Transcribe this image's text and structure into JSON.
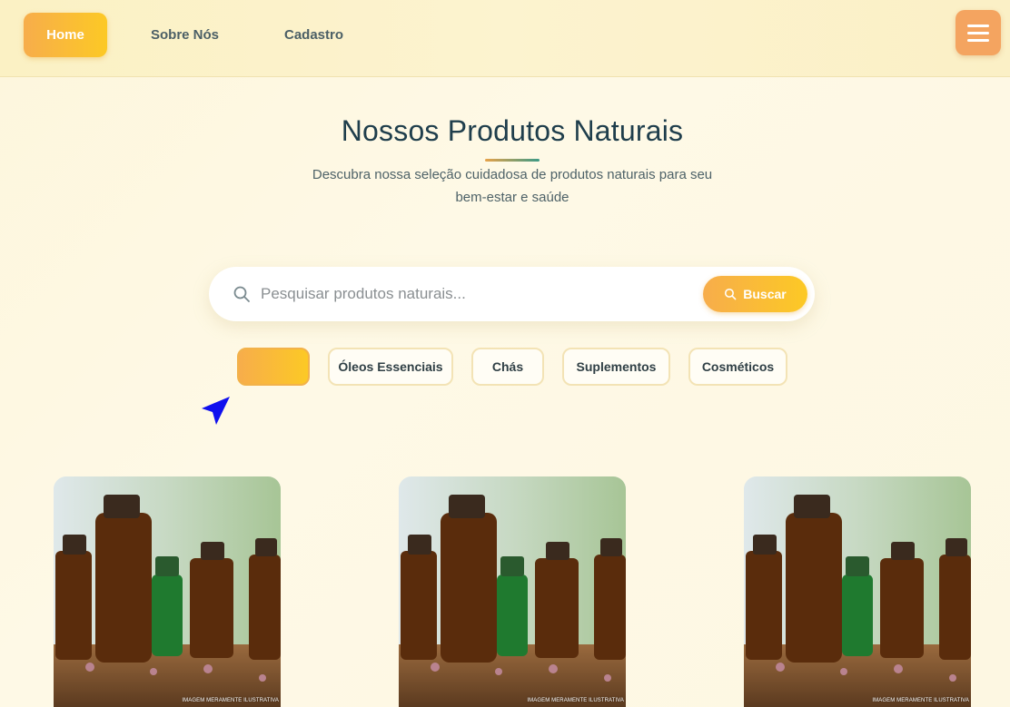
{
  "nav": {
    "home_label": "Home",
    "about_label": "Sobre Nós",
    "register_label": "Cadastro",
    "menu_icon": "hamburger-menu-icon"
  },
  "hero": {
    "title": "Nossos Produtos Naturais",
    "subtitle": "Descubra nossa seleção cuidadosa de produtos naturais para seu bem-estar e saúde"
  },
  "search": {
    "placeholder": "Pesquisar produtos naturais...",
    "value": "",
    "button_label": "Buscar",
    "icon": "search-icon"
  },
  "filters": [
    {
      "label": "",
      "active": true
    },
    {
      "label": "Óleos Essenciais",
      "active": false
    },
    {
      "label": "Chás",
      "active": false
    },
    {
      "label": "Suplementos",
      "active": false
    },
    {
      "label": "Cosméticos",
      "active": false
    }
  ],
  "products": [
    {
      "image_caption": "IMAGEM MERAMENTE ILUSTRATIVA"
    },
    {
      "image_caption": "IMAGEM MERAMENTE ILUSTRATIVA"
    },
    {
      "image_caption": "IMAGEM MERAMENTE ILUSTRATIVA"
    }
  ],
  "colors": {
    "accent_start": "#f7ad4b",
    "accent_end": "#fcc925",
    "title": "#1f3e4c",
    "menu_button": "#f4a460"
  }
}
